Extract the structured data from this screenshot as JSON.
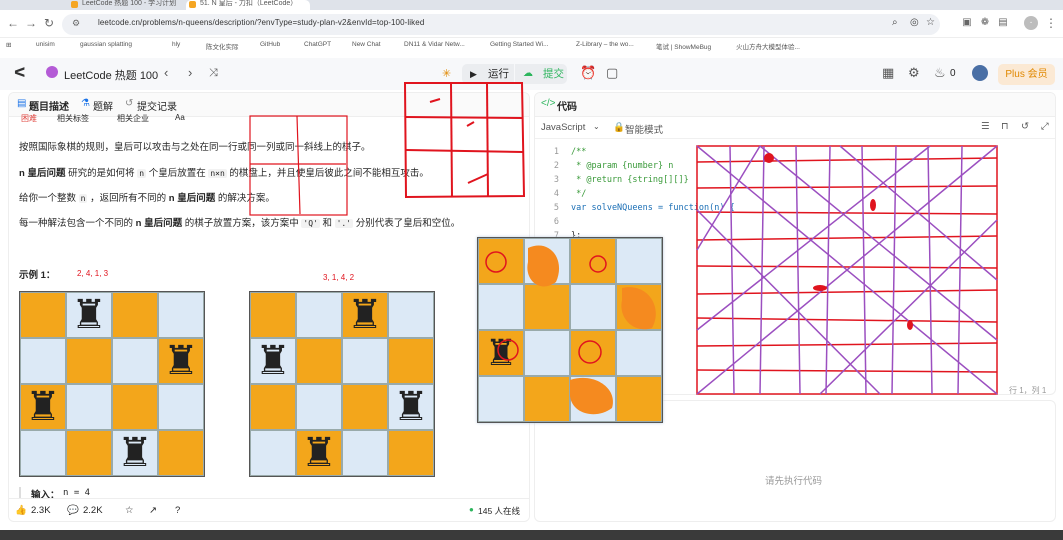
{
  "browser": {
    "tabs": [
      {
        "title": "LeetCode 热题 100 - 学习计划"
      },
      {
        "title": "51. N 皇后 - 力扣（LeetCode）"
      }
    ],
    "url": "leetcode.cn/problems/n-queens/description/?envType=study-plan-v2&envId=top-100-liked",
    "bookmarks": [
      "unisim",
      "gaussian splatting",
      "hly",
      "陈文化实际",
      "GitHub",
      "ChatGPT",
      "New Chat",
      "DN11 & Vidar Netw...",
      "Getting Started Wi...",
      "Z-Library – the wo...",
      "笔试 | ShowMeBug",
      "火山方舟大模型体验..."
    ]
  },
  "header": {
    "study_plan": "LeetCode 热题 100",
    "run_label": "运行",
    "submit_label": "提交",
    "notif_count": "0",
    "plus_label": "Plus 会员"
  },
  "left": {
    "tabs": [
      "题目描述",
      "题解",
      "提交记录"
    ],
    "tag_chips": [
      "困难",
      "相关标签",
      "相关企业",
      "Aa"
    ],
    "p1": "按照国际象棋的规则，皇后可以攻击与之处在同一行或同一列或同一斜线上的棋子。",
    "p2_bold": "n 皇后问题",
    "p2_a": " 研究的是如何将 ",
    "p2_n": "n",
    "p2_b": " 个皇后放置在 ",
    "p2_nxn": "n×n",
    "p2_c": " 的棋盘上，并且使皇后彼此之间不能相互攻击。",
    "p3_a": "给你一个整数 ",
    "p3_n": "n",
    "p3_b": " ，返回所有不同的 ",
    "p3_bold": "n 皇后问题",
    "p3_c": " 的解决方案。",
    "p4_a": "每一种解法包含一个不同的 ",
    "p4_bold": "n 皇后问题",
    "p4_b": " 的棋子放置方案，该方案中 ",
    "p4_q": "'Q'",
    "p4_and": " 和 ",
    "p4_dot": "'.'",
    "p4_c": " 分别代表了皇后和空位。",
    "example_title": "示例 1：",
    "board1_note": "2, 4, 1, 3",
    "board2_note": "3, 1, 4, 2",
    "input_label": "输入：",
    "input_value": "n = 4",
    "likes": "2.3K",
    "comments": "2.2K",
    "online": "145 人在线"
  },
  "code": {
    "tab_label": "代码",
    "language": "JavaScript",
    "mode": "智能模式",
    "lines": [
      {
        "n": "1",
        "t": "/**"
      },
      {
        "n": "2",
        "t": " * @param {number} n"
      },
      {
        "n": "3",
        "t": " * @return {string[][]}"
      },
      {
        "n": "4",
        "t": " */"
      },
      {
        "n": "5",
        "t": "var solveNQueens = function(n) {"
      },
      {
        "n": "6",
        "t": ""
      },
      {
        "n": "7",
        "t": "};"
      }
    ],
    "cursor_pos": "行 1，列 1"
  },
  "result": {
    "placeholder": "请先执行代码"
  },
  "colors": {
    "orange": "#f3a61b",
    "light_blue": "#dce9f6",
    "annotation_red": "#e0141e",
    "annotation_purple": "#9b4fc0",
    "annotation_orange": "#f58a1f",
    "submit_green": "#2db55d"
  },
  "boards": {
    "board1_queens": "♜",
    "board2_queens": "♜",
    "popup_queens": "♜"
  }
}
